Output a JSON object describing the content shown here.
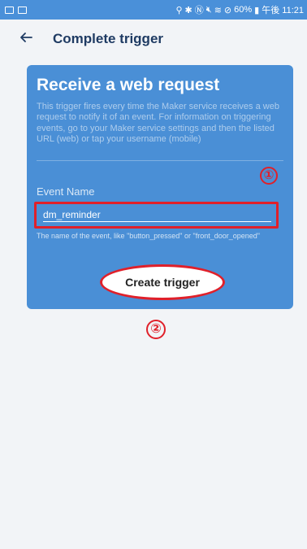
{
  "status_bar": {
    "right_text": "60%",
    "time": "午後 11:21",
    "icons": [
      "image-icon",
      "clipboard-icon",
      "location-icon",
      "bluetooth-icon",
      "nfc-icon",
      "mute-icon",
      "wifi-icon",
      "no-sim-icon",
      "battery-icon"
    ]
  },
  "header": {
    "title": "Complete trigger",
    "back_icon": "arrow-left-icon"
  },
  "card": {
    "title": "Receive a web request",
    "description": "This trigger fires every time the Maker service receives a web request to notify it of an event. For information on triggering events, go to your Maker service settings and then the listed URL (web) or tap your username (mobile)",
    "event_label": "Event Name",
    "event_value": "dm_reminder",
    "help_text": "The name of the event, like \"button_pressed\" or \"front_door_opened\"",
    "button_label": "Create trigger"
  },
  "annotations": {
    "marker_1": "①",
    "marker_2": "②",
    "color": "#e0202a"
  },
  "colors": {
    "accent": "#4a8fd6",
    "title": "#1f3b63",
    "background": "#f2f4f7"
  }
}
